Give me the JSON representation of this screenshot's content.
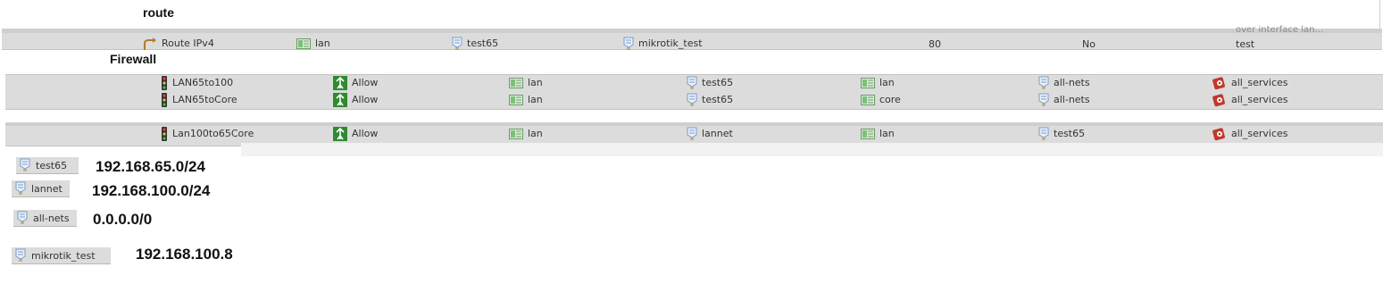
{
  "route_section": {
    "title": "route",
    "row": {
      "type": "Route IPv4",
      "interface": "lan",
      "network": "test65",
      "gateway": "mikrotik_test",
      "metric": "80",
      "proxy_arp": "No",
      "comment_cut": "over interface lan...",
      "comment": "test"
    }
  },
  "firewall_section": {
    "title": "Firewall",
    "rules": [
      {
        "name": "LAN65to100",
        "action": "Allow",
        "src_if": "lan",
        "src_net": "test65",
        "dst_if": "lan",
        "dst_net": "all-nets",
        "service": "all_services"
      },
      {
        "name": "LAN65toCore",
        "action": "Allow",
        "src_if": "lan",
        "src_net": "test65",
        "dst_if": "core",
        "dst_net": "all-nets",
        "service": "all_services"
      },
      {
        "name": "Lan100to65Core",
        "action": "Allow",
        "src_if": "lan",
        "src_net": "lannet",
        "dst_if": "lan",
        "dst_net": "test65",
        "service": "all_services"
      }
    ]
  },
  "address_objects": [
    {
      "name": "test65",
      "value": "192.168.65.0/24"
    },
    {
      "name": "lannet",
      "value": "192.168.100.0/24"
    },
    {
      "name": "all-nets",
      "value": "0.0.0.0/0"
    },
    {
      "name": "mikrotik_test",
      "value": "192.168.100.8"
    }
  ],
  "colors": {
    "row_bg": "#dedede",
    "allow_green": "#2e8b2e",
    "service_red": "#c0392b",
    "interface_green": "#6fbf6f",
    "address_blue": "#7a9cc6"
  }
}
